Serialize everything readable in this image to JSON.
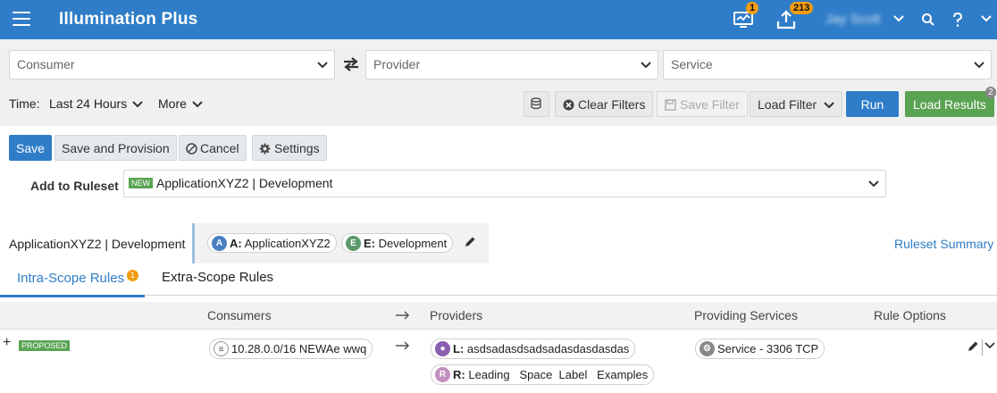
{
  "header": {
    "app_title": "Illumination Plus",
    "notifications_count": "1",
    "uploads_count": "213",
    "user_name": "Jay Scott"
  },
  "filters": {
    "consumer_placeholder": "Consumer",
    "provider_placeholder": "Provider",
    "service_placeholder": "Service",
    "time_label": "Time:",
    "time_value": "Last 24 Hours",
    "more_label": "More",
    "clear_filters": "Clear Filters",
    "save_filter": "Save Filter",
    "load_filter": "Load Filter",
    "run": "Run",
    "load_results": "Load Results",
    "load_results_count": "2"
  },
  "actions": {
    "save": "Save",
    "save_and_provision": "Save and Provision",
    "cancel": "Cancel",
    "settings": "Settings"
  },
  "ruleset": {
    "label": "Add to Ruleset",
    "new_tag": "NEW",
    "value": "ApplicationXYZ2 | Development"
  },
  "scope": {
    "name": "ApplicationXYZ2 | Development",
    "app_prefix": "A:",
    "app_value": "ApplicationXYZ2",
    "env_prefix": "E:",
    "env_value": "Development",
    "summary_link": "Ruleset Summary"
  },
  "tabs": {
    "intra": "Intra-Scope Rules",
    "intra_badge": "1",
    "extra": "Extra-Scope Rules"
  },
  "table": {
    "headers": {
      "consumers": "Consumers",
      "providers": "Providers",
      "services": "Providing Services",
      "options": "Rule Options"
    },
    "row": {
      "status": "PROPOSED",
      "consumer": "10.28.0.0/16 NEWAe wwq",
      "provider1_prefix": "L:",
      "provider1_value": "asdsadasdsadsadasdasdasdas",
      "provider2_prefix": "R:",
      "provider2_value": "Leading   Space  Label   Examples",
      "service": "Service - 3306 TCP"
    }
  },
  "colors": {
    "primary": "#2f7dc8",
    "green": "#5aa353",
    "badge_orange": "#f39c12"
  }
}
